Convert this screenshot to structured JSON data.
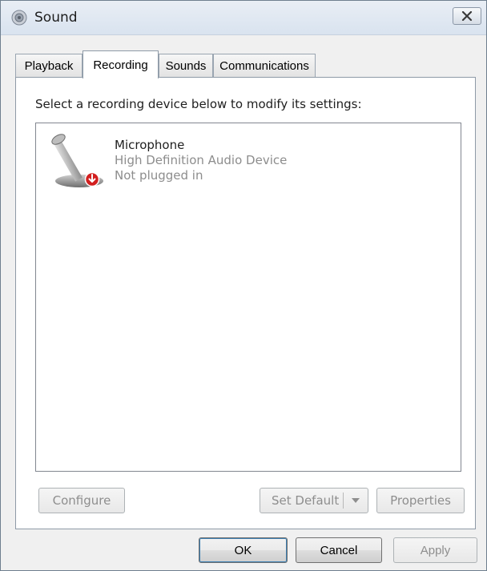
{
  "window": {
    "title": "Sound",
    "icon": "speaker-icon",
    "close_icon": "close-icon"
  },
  "tabs": [
    {
      "label": "Playback",
      "active": false
    },
    {
      "label": "Recording",
      "active": true
    },
    {
      "label": "Sounds",
      "active": false
    },
    {
      "label": "Communications",
      "active": false
    }
  ],
  "recording": {
    "instruction": "Select a recording device below to modify its settings:",
    "devices": [
      {
        "name": "Microphone",
        "description": "High Definition Audio Device",
        "status": "Not plugged in",
        "icon": "microphone-icon",
        "status_icon": "unplugged-icon"
      }
    ],
    "buttons": {
      "configure": "Configure",
      "set_default": "Set Default",
      "properties": "Properties"
    }
  },
  "footer": {
    "ok": "OK",
    "cancel": "Cancel",
    "apply": "Apply"
  },
  "colors": {
    "disabled_text": "#8e8e8e",
    "status_red": "#d22020",
    "titlebar": "#dde6f0"
  }
}
